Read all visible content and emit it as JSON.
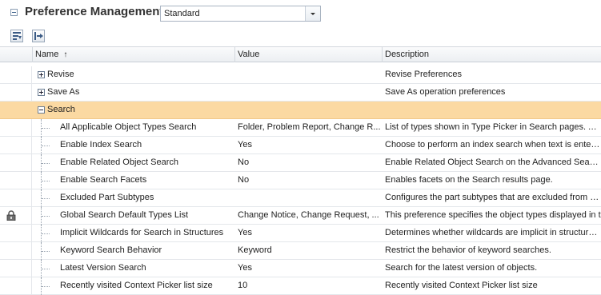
{
  "title": "Preference Management",
  "view_select": {
    "value": "Standard"
  },
  "columns": {
    "name": "Name",
    "value": "Value",
    "description": "Description"
  },
  "groups": [
    {
      "label": "Revise",
      "expanded": false,
      "description": "Revise Preferences"
    },
    {
      "label": "Save As",
      "expanded": false,
      "description": "Save As operation preferences"
    },
    {
      "label": "Search",
      "expanded": true,
      "description": ""
    }
  ],
  "rows": [
    {
      "name": "All Applicable Object Types Search",
      "value": "Folder, Problem Report, Change R...",
      "description": "List of types shown in Type Picker in Search pages. Also",
      "locked": false
    },
    {
      "name": "Enable Index Search",
      "value": "Yes",
      "description": "Choose to perform an index search when text is entered",
      "locked": false
    },
    {
      "name": "Enable Related Object Search",
      "value": "No",
      "description": "Enable Related Object Search on the Advanced Search",
      "locked": false
    },
    {
      "name": "Enable Search Facets",
      "value": "No",
      "description": "Enables facets on the Search results page.",
      "locked": false
    },
    {
      "name": "Excluded Part Subtypes",
      "value": "",
      "description": "Configures the part subtypes that are excluded from sea",
      "locked": false
    },
    {
      "name": "Global Search Default Types List",
      "value": "Change Notice, Change Request, ...",
      "description": "This preference specifies the object types displayed in t",
      "locked": true
    },
    {
      "name": "Implicit Wildcards for Search in Structures",
      "value": "Yes",
      "description": "Determines whether wildcards are implicit in structure-re",
      "locked": false
    },
    {
      "name": "Keyword Search Behavior",
      "value": "Keyword",
      "description": "Restrict the behavior of keyword searches.",
      "locked": false
    },
    {
      "name": "Latest Version Search",
      "value": "Yes",
      "description": "Search for the latest version of objects.",
      "locked": false
    },
    {
      "name": "Recently visited Context Picker list size",
      "value": "10",
      "description": "Recently visited Context Picker list size",
      "locked": false
    }
  ],
  "icons": {
    "collapse_title": "collapse-icon",
    "filter": "filter-icon",
    "expand_all": "expand-all-icon",
    "lock": "lock-icon",
    "sort": "sort-ascending-icon"
  },
  "colors": {
    "selected_row": "#fbd9a2",
    "header_bg": "#eceff2"
  }
}
